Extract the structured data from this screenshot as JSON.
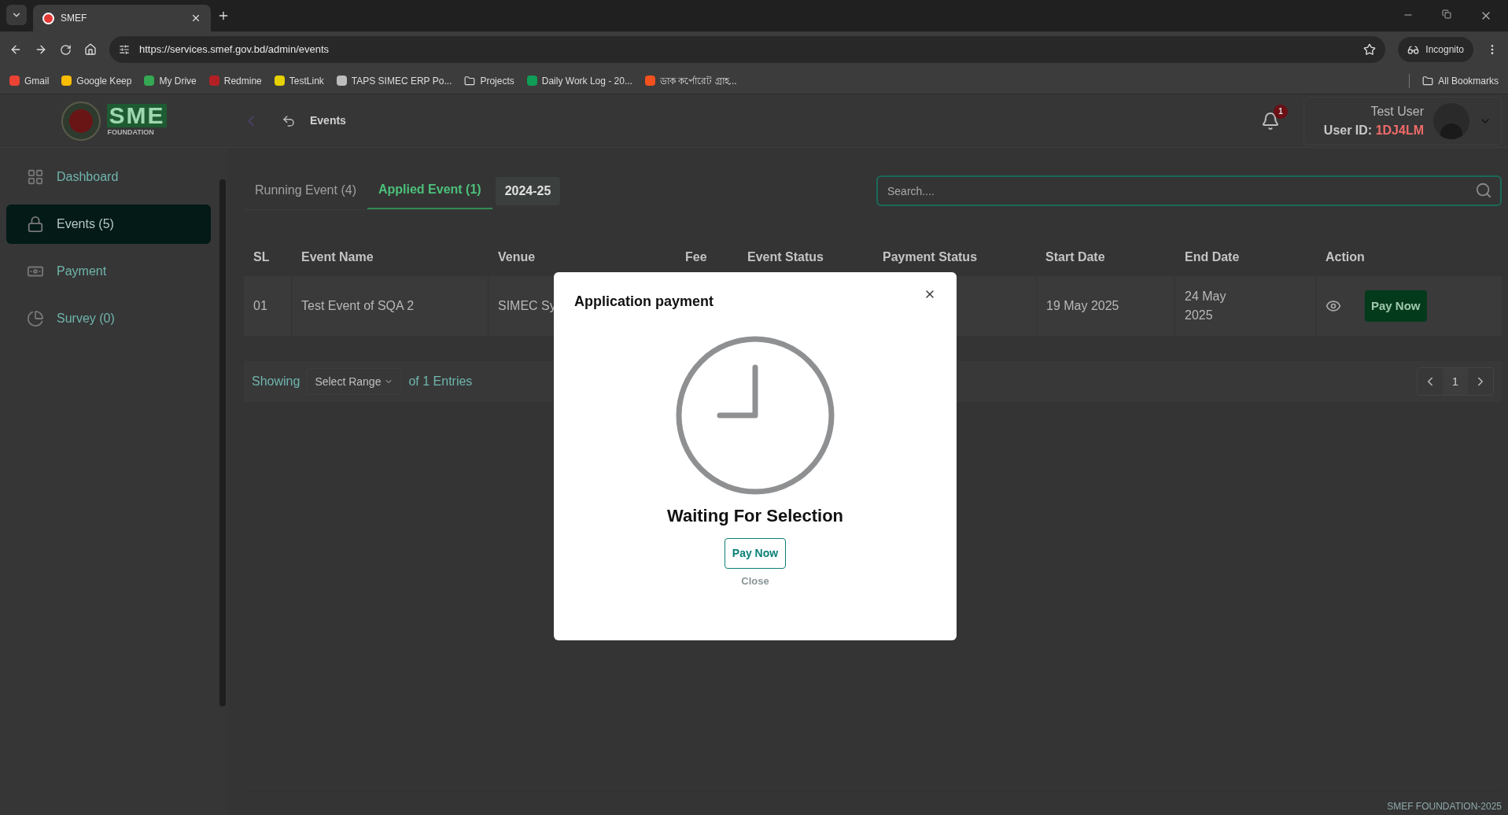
{
  "browser": {
    "tab_title": "SMEF",
    "url": "https://services.smef.gov.bd/admin/events",
    "profile": "Incognito",
    "bookmarks": [
      {
        "label": "Gmail",
        "kind": "site",
        "color": "#ea4335"
      },
      {
        "label": "Google Keep",
        "kind": "site",
        "color": "#fbbc04"
      },
      {
        "label": "My Drive",
        "kind": "site",
        "color": "#34a853"
      },
      {
        "label": "Redmine",
        "kind": "site",
        "color": "#b32024"
      },
      {
        "label": "TestLink",
        "kind": "site",
        "color": "#e6d200"
      },
      {
        "label": "TAPS SIMEC ERP Po...",
        "kind": "site",
        "color": "#bdbdbd"
      },
      {
        "label": "Projects",
        "kind": "folder"
      },
      {
        "label": "Daily Work Log - 20...",
        "kind": "site",
        "color": "#0f9d58"
      },
      {
        "label": "ডাক কর্পোরেট গ্রাহ...",
        "kind": "site",
        "color": "#f4511e"
      }
    ],
    "all_bookmarks": "All Bookmarks"
  },
  "logo": {
    "mark": "SME",
    "subtitle": "FOUNDATION"
  },
  "header": {
    "title": "Events",
    "notifications": "1",
    "user_name": "Test User",
    "user_id_label": "User ID:",
    "user_id": "1DJ4LM"
  },
  "sidebar": {
    "items": [
      {
        "label": "Dashboard",
        "selected": false
      },
      {
        "label": "Events (5)",
        "selected": true
      },
      {
        "label": "Payment",
        "selected": false
      },
      {
        "label": "Survey (0)",
        "selected": false
      }
    ]
  },
  "tabs": [
    {
      "label": "Running Event (4)",
      "selected": false
    },
    {
      "label": "Applied Event (1)",
      "selected": true
    }
  ],
  "year": "2024-25",
  "search": {
    "placeholder": "Search...."
  },
  "table": {
    "columns": [
      "SL",
      "Event Name",
      "Venue",
      "Fee",
      "Event Status",
      "Payment Status",
      "Start Date",
      "End Date",
      "Action"
    ],
    "rows": [
      {
        "sl": "01",
        "event_name": "Test Event of SQA 2",
        "venue": "SIMEC Sy",
        "start_date": "19 May 2025",
        "end_date": "24 May 2025",
        "action": "Pay Now"
      }
    ]
  },
  "pagination": {
    "showing": "Showing",
    "range": "Select Range",
    "entries": "of 1 Entries",
    "page": "1"
  },
  "modal": {
    "title": "Application payment",
    "status": "Waiting For Selection",
    "primary": "Pay Now",
    "secondary": "Close"
  },
  "footer": "SMEF FOUNDATION-2025"
}
